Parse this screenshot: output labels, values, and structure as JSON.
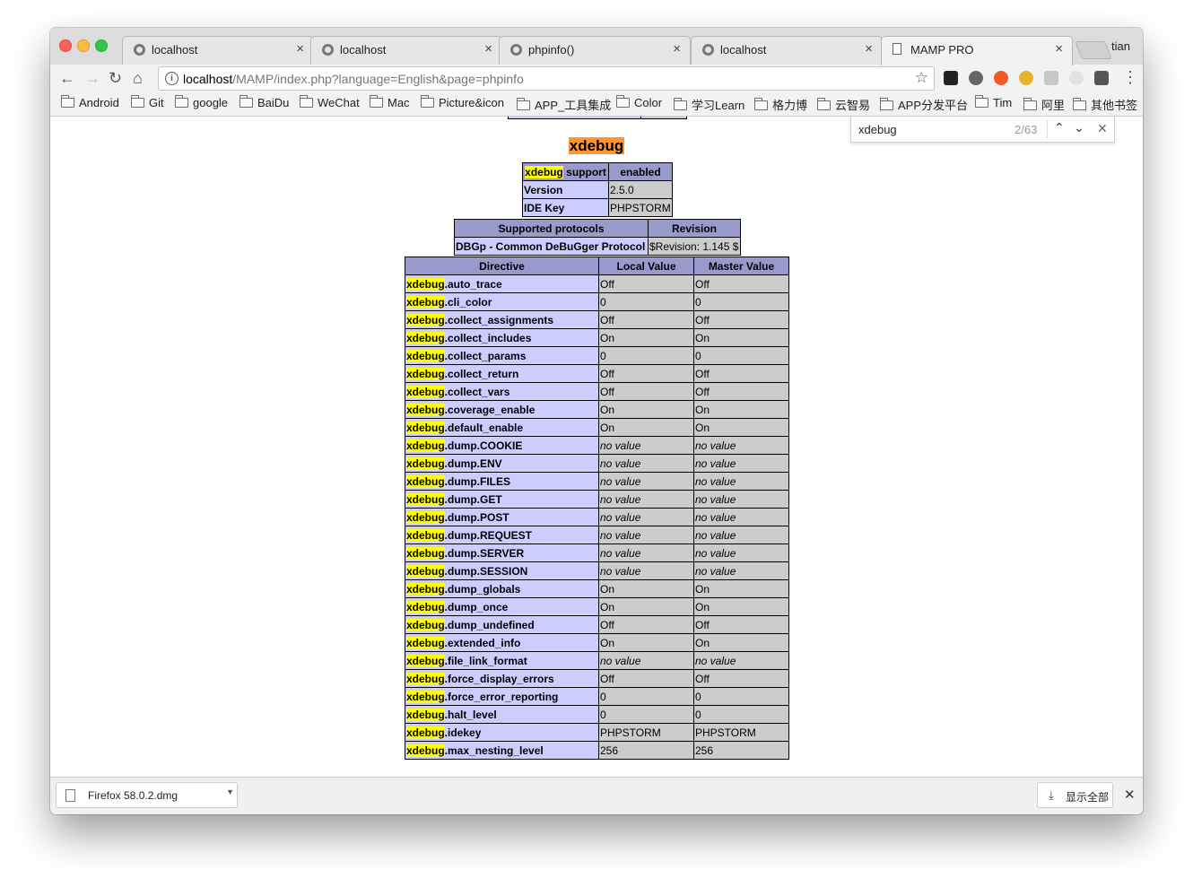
{
  "tabs": [
    {
      "title": "localhost",
      "icon": "github-icon",
      "active": false
    },
    {
      "title": "localhost",
      "icon": "github-icon",
      "active": false
    },
    {
      "title": "phpinfo()",
      "icon": "github-icon",
      "active": false
    },
    {
      "title": "localhost",
      "icon": "github-icon",
      "active": false
    },
    {
      "title": "MAMP PRO",
      "icon": "page-icon",
      "active": true
    }
  ],
  "profile_name": "tian",
  "address": {
    "host": "localhost",
    "path": "/MAMP/index.php?language=English&page=phpinfo"
  },
  "bookmarks": [
    "Android",
    "Git",
    "google",
    "BaiDu",
    "WeChat",
    "Mac",
    "Picture&icon",
    "APP_工具集成",
    "Color",
    "学习Learn",
    "格力博",
    "云智易",
    "APP分发平台",
    "Tim",
    "阿里",
    "其他书签"
  ],
  "find": {
    "query": "xdebug",
    "count": "2/63"
  },
  "section_title": "xdebug",
  "support_table": {
    "support_label_prefix": "xdebug",
    "support_label_suffix": " support",
    "support_value": "enabled",
    "rows": [
      {
        "key": "Version",
        "value": "2.5.0"
      },
      {
        "key": "IDE Key",
        "value": "PHPSTORM"
      }
    ]
  },
  "protocols_table": {
    "headers": [
      "Supported protocols",
      "Revision"
    ],
    "row": {
      "protocol": "DBGp - Common DeBuGger Protocol",
      "revision": "$Revision: 1.145 $"
    }
  },
  "directives_table": {
    "headers": [
      "Directive",
      "Local Value",
      "Master Value"
    ],
    "prefix": "xdebug",
    "rows": [
      {
        "name": ".auto_trace",
        "local": "Off",
        "master": "Off"
      },
      {
        "name": ".cli_color",
        "local": "0",
        "master": "0"
      },
      {
        "name": ".collect_assignments",
        "local": "Off",
        "master": "Off"
      },
      {
        "name": ".collect_includes",
        "local": "On",
        "master": "On"
      },
      {
        "name": ".collect_params",
        "local": "0",
        "master": "0"
      },
      {
        "name": ".collect_return",
        "local": "Off",
        "master": "Off"
      },
      {
        "name": ".collect_vars",
        "local": "Off",
        "master": "Off"
      },
      {
        "name": ".coverage_enable",
        "local": "On",
        "master": "On"
      },
      {
        "name": ".default_enable",
        "local": "On",
        "master": "On"
      },
      {
        "name": ".dump.COOKIE",
        "local": "no value",
        "master": "no value"
      },
      {
        "name": ".dump.ENV",
        "local": "no value",
        "master": "no value"
      },
      {
        "name": ".dump.FILES",
        "local": "no value",
        "master": "no value"
      },
      {
        "name": ".dump.GET",
        "local": "no value",
        "master": "no value"
      },
      {
        "name": ".dump.POST",
        "local": "no value",
        "master": "no value"
      },
      {
        "name": ".dump.REQUEST",
        "local": "no value",
        "master": "no value"
      },
      {
        "name": ".dump.SERVER",
        "local": "no value",
        "master": "no value"
      },
      {
        "name": ".dump.SESSION",
        "local": "no value",
        "master": "no value"
      },
      {
        "name": ".dump_globals",
        "local": "On",
        "master": "On"
      },
      {
        "name": ".dump_once",
        "local": "On",
        "master": "On"
      },
      {
        "name": ".dump_undefined",
        "local": "Off",
        "master": "Off"
      },
      {
        "name": ".extended_info",
        "local": "On",
        "master": "On"
      },
      {
        "name": ".file_link_format",
        "local": "no value",
        "master": "no value"
      },
      {
        "name": ".force_display_errors",
        "local": "Off",
        "master": "Off"
      },
      {
        "name": ".force_error_reporting",
        "local": "0",
        "master": "0"
      },
      {
        "name": ".halt_level",
        "local": "0",
        "master": "0"
      },
      {
        "name": ".idekey",
        "local": "PHPSTORM",
        "master": "PHPSTORM"
      },
      {
        "name": ".max_nesting_level",
        "local": "256",
        "master": "256"
      }
    ]
  },
  "download": {
    "filename": "Firefox 58.0.2.dmg",
    "show_all_label": "显示全部"
  },
  "colors": {
    "find_highlight_current": "#ff9632",
    "find_highlight": "#ffff00",
    "php_header": "#9999cc",
    "php_key": "#ccccff",
    "php_value": "#cccccc"
  }
}
